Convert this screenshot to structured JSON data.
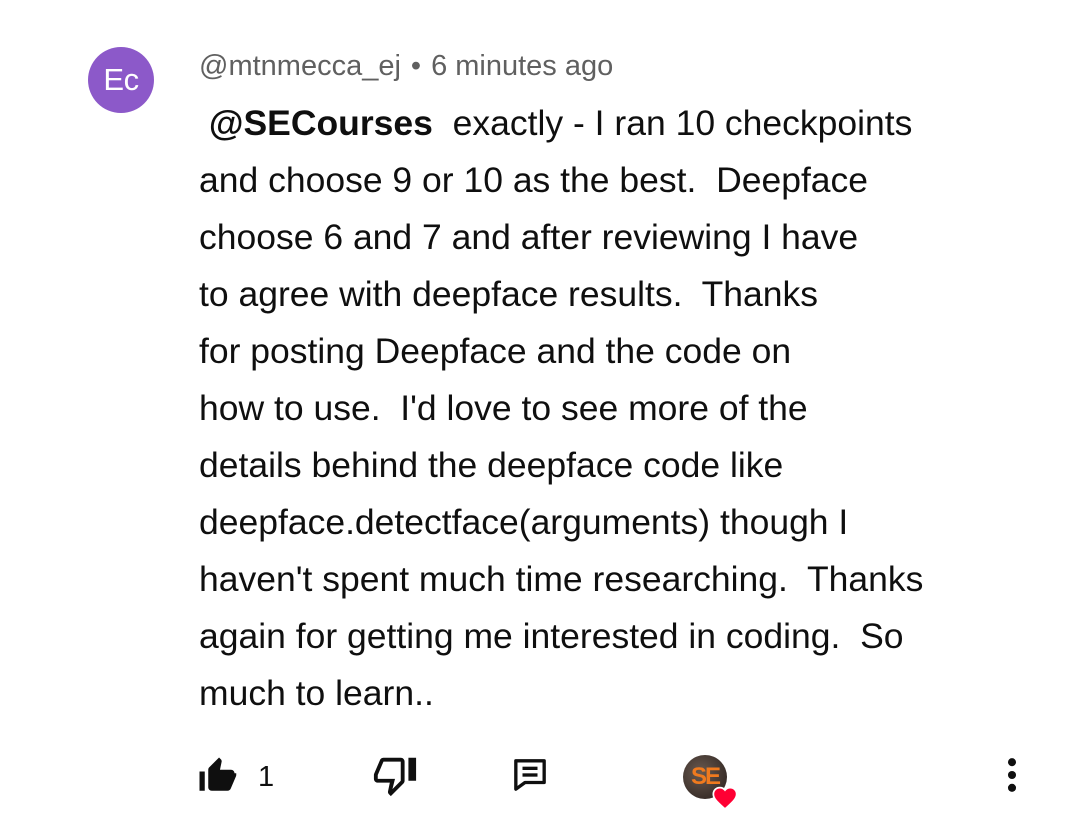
{
  "comment": {
    "avatar_initials": "Ec",
    "avatar_color": "#8c59c9",
    "author": "@mtnmecca_ej",
    "separator": "•",
    "timestamp": "6 minutes ago",
    "mention": "@SECourses",
    "lines": [
      " exactly - I ran 10 checkpoints",
      "and choose 9 or 10 as the best.  Deepface",
      "choose 6 and 7 and after reviewing I have",
      "to agree with deepface results.  Thanks",
      "for posting Deepface and the code on",
      "how to use.  I'd love to see more of the",
      "details behind the deepface code like",
      "deepface.detectface(arguments) though I",
      "haven't spent much time researching.  Thanks",
      "again for getting me interested in coding.  So",
      "much to learn.."
    ]
  },
  "actions": {
    "like_count": "1",
    "like_icon": "thumbs-up-filled-icon",
    "dislike_icon": "thumbs-down-icon",
    "reply_icon": "reply-icon",
    "creator_badge_text": "SE",
    "creator_heart_color": "#ff0033",
    "more_icon": "more-vert-icon"
  }
}
